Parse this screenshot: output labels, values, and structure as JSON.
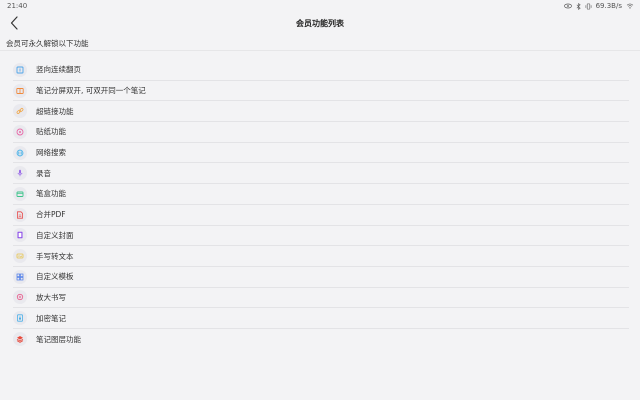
{
  "status_bar": {
    "time": "21:40",
    "network_speed": "69.3B/s"
  },
  "header": {
    "title": "会员功能列表",
    "back_icon": "chevron-left-icon"
  },
  "subtitle": "会员可永久解锁以下功能",
  "features": [
    {
      "label": "竖向连续翻页",
      "icon": "vertical-scroll-icon",
      "color": "#4aa3e8"
    },
    {
      "label": "笔记分屏双开, 可双开同一个笔记",
      "icon": "split-screen-icon",
      "color": "#f08a3c"
    },
    {
      "label": "超链接功能",
      "icon": "link-icon",
      "color": "#f0a84a"
    },
    {
      "label": "贴纸功能",
      "icon": "sticker-icon",
      "color": "#e86aa8"
    },
    {
      "label": "网络搜索",
      "icon": "globe-icon",
      "color": "#4ab3e8"
    },
    {
      "label": "录音",
      "icon": "microphone-icon",
      "color": "#9a6ae8"
    },
    {
      "label": "笔盒功能",
      "icon": "pen-box-icon",
      "color": "#3cc48a"
    },
    {
      "label": "合并PDF",
      "icon": "merge-pdf-icon",
      "color": "#e84a4a"
    },
    {
      "label": "自定义封面",
      "icon": "cover-icon",
      "color": "#8a4ae8"
    },
    {
      "label": "手写转文本",
      "icon": "handwriting-text-icon",
      "color": "#e8c44a"
    },
    {
      "label": "自定义模板",
      "icon": "template-icon",
      "color": "#4a7ae8"
    },
    {
      "label": "放大书写",
      "icon": "magnify-write-icon",
      "color": "#e85a8a"
    },
    {
      "label": "加密笔记",
      "icon": "encrypted-note-icon",
      "color": "#4ab0e8"
    },
    {
      "label": "笔记图层功能",
      "icon": "layers-icon",
      "color": "#e84a3c"
    }
  ]
}
